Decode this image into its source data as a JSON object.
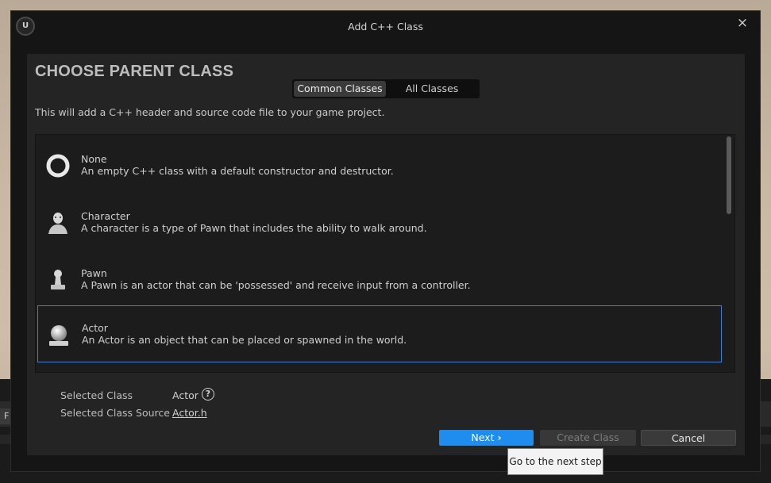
{
  "window": {
    "title": "Add C++ Class",
    "logo_text": "U",
    "close_glyph": "×"
  },
  "panel": {
    "heading": "CHOOSE PARENT CLASS",
    "tabs": [
      {
        "label": "Common Classes",
        "active": true
      },
      {
        "label": "All Classes",
        "active": false
      }
    ],
    "description": "This will add a C++ header and source code file to your game project."
  },
  "classes": [
    {
      "name": "None",
      "description": "An empty C++ class with a default constructor and destructor.",
      "icon": "none-ring-icon",
      "selected": false
    },
    {
      "name": "Character",
      "description": "A character is a type of Pawn that includes the ability to walk around.",
      "icon": "character-icon",
      "selected": false
    },
    {
      "name": "Pawn",
      "description": "A Pawn is an actor that can be 'possessed' and receive input from a controller.",
      "icon": "pawn-icon",
      "selected": false
    },
    {
      "name": "Actor",
      "description": "An Actor is an object that can be placed or spawned in the world.",
      "icon": "actor-sphere-icon",
      "selected": true
    }
  ],
  "selection": {
    "class_label": "Selected Class",
    "class_value": "Actor",
    "source_label": "Selected Class Source",
    "source_value": "Actor.h"
  },
  "buttons": {
    "next": "Next",
    "create": "Create Class",
    "cancel": "Cancel"
  },
  "tooltip": "Go to the next step",
  "edge_left_glyph": "F",
  "edge_right_glyph": "⁝",
  "colors": {
    "accent": "#1f8cf0",
    "selection_border": "#3c7fd0",
    "panel_bg": "#242424",
    "dialog_bg": "#151515"
  }
}
